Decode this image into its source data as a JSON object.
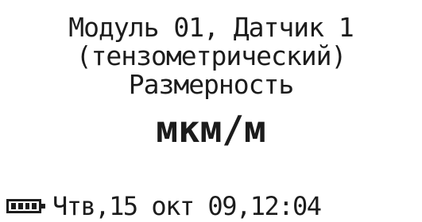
{
  "display": {
    "line1": "Модуль 01, Датчик 1",
    "line2": "(тензометрический)",
    "line3": "Размерность",
    "unit_value": "мкм/м"
  },
  "status_bar": {
    "battery_icon": "battery-full-icon",
    "battery_level": 1.0,
    "datetime": "Чтв,15 окт 09,12:04"
  }
}
